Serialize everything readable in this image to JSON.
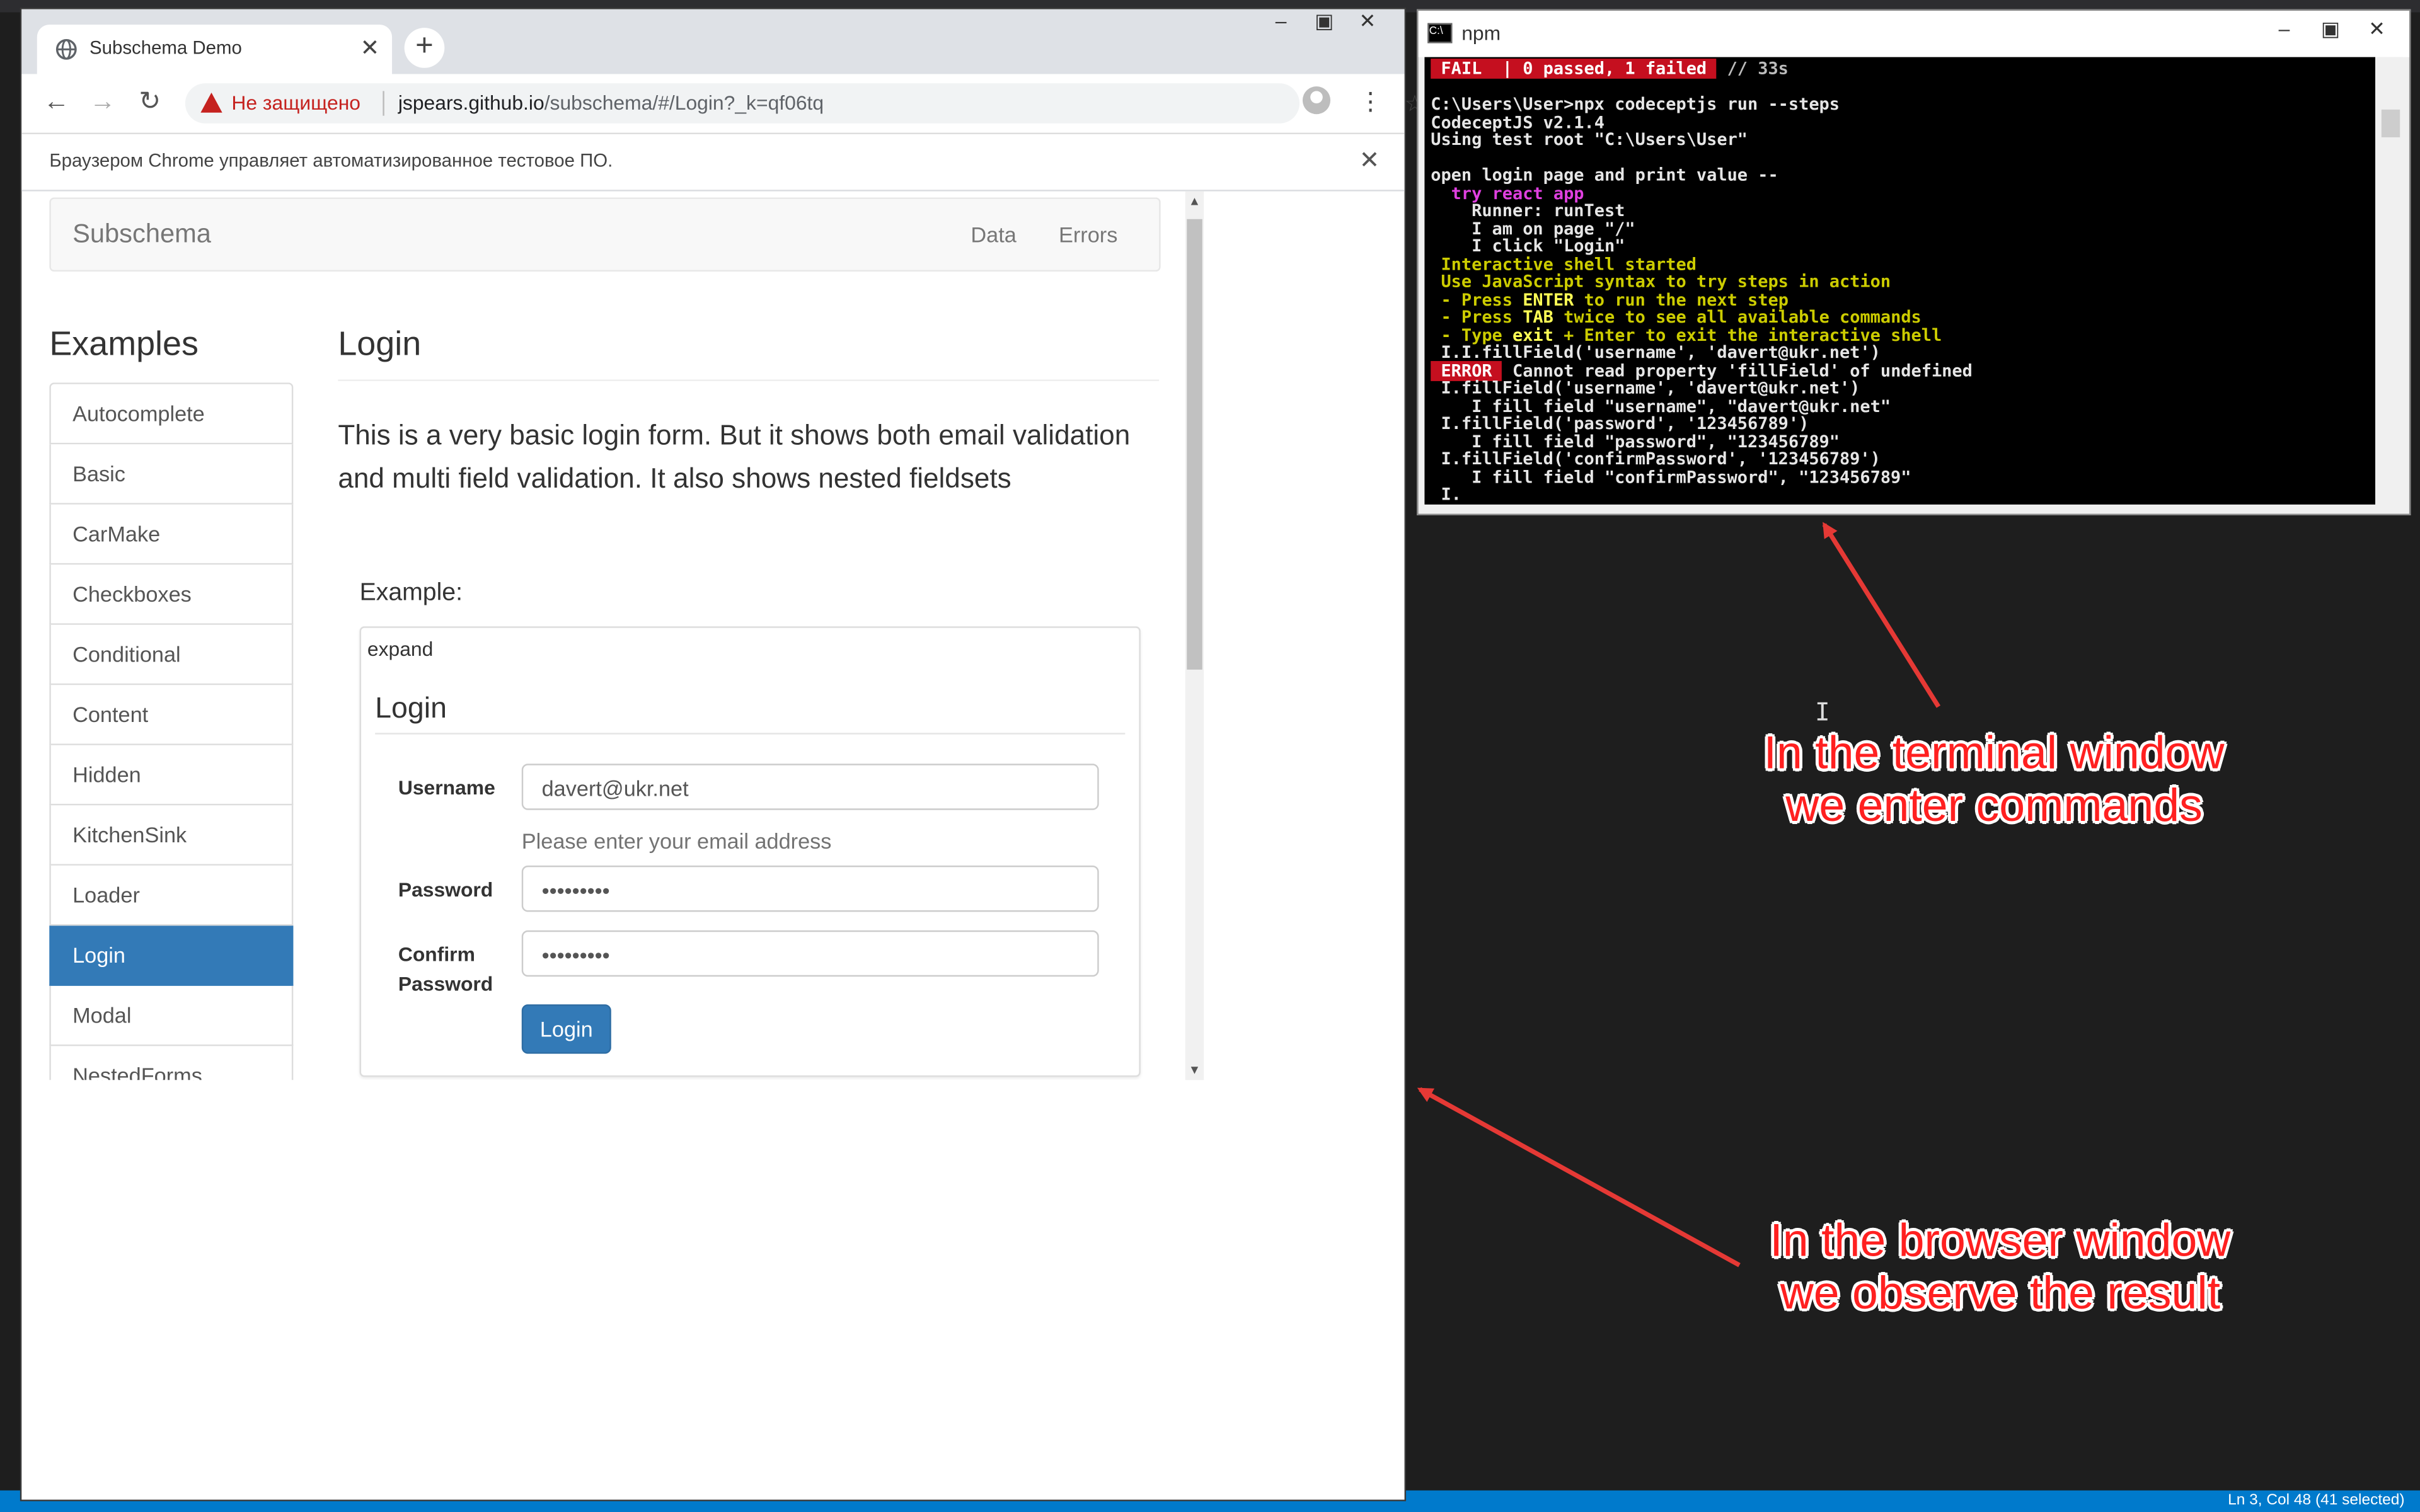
{
  "browser": {
    "tab_title": "Subschema Demo",
    "new_tab_symbol": "+",
    "warning_text": "Не защищено",
    "url_host": "jspears.github.io",
    "url_path": "/subschema/#/Login?_k=qf06tq",
    "infobar_text": "Браузером Chrome управляет автоматизированное тестовое ПО."
  },
  "site": {
    "brand": "Subschema",
    "nav": [
      "Data",
      "Errors"
    ],
    "examples_heading": "Examples",
    "examples": [
      "Autocomplete",
      "Basic",
      "CarMake",
      "Checkboxes",
      "Conditional",
      "Content",
      "Hidden",
      "KitchenSink",
      "Loader",
      "Login",
      "Modal",
      "NestedForms"
    ],
    "active_example": "Login",
    "title": "Login",
    "description": "This is a very basic login form. But it shows both email validation and multi field validation. It also shows nested fieldsets",
    "example_label": "Example:",
    "expand_label": "expand",
    "form": {
      "legend": "Login",
      "username_label": "Username",
      "username_value": "davert@ukr.net",
      "username_help": "Please enter your email address",
      "password_label": "Password",
      "password_value": "•••••••••",
      "confirm_label_1": "Confirm",
      "confirm_label_2": "Password",
      "confirm_value": "•••••••••",
      "submit_label": "Login"
    }
  },
  "terminal": {
    "title": "npm",
    "lines": [
      {
        "parts": [
          {
            "t": " FAIL  | 0 passed, 1 failed ",
            "c": "fail"
          },
          {
            "t": " // 33s",
            "c": "g"
          }
        ]
      },
      {
        "parts": [
          {
            "t": "",
            "c": "w"
          }
        ]
      },
      {
        "parts": [
          {
            "t": "C:\\Users\\User>npx codeceptjs run --steps",
            "c": "w"
          }
        ]
      },
      {
        "parts": [
          {
            "t": "CodeceptJS v2.1.4",
            "c": "w"
          }
        ]
      },
      {
        "parts": [
          {
            "t": "Using test root \"C:\\Users\\User\"",
            "c": "w"
          }
        ]
      },
      {
        "parts": [
          {
            "t": "",
            "c": "w"
          }
        ]
      },
      {
        "parts": [
          {
            "t": "open login page and print value --",
            "c": "w"
          }
        ]
      },
      {
        "parts": [
          {
            "t": "  try react app",
            "c": "m"
          }
        ]
      },
      {
        "parts": [
          {
            "t": "    Runner: runTest",
            "c": "w"
          }
        ]
      },
      {
        "parts": [
          {
            "t": "    I am on page \"/\"",
            "c": "w"
          }
        ]
      },
      {
        "parts": [
          {
            "t": "    I click \"Login\"",
            "c": "w"
          }
        ]
      },
      {
        "parts": [
          {
            "t": " Interactive shell started",
            "c": "y"
          }
        ]
      },
      {
        "parts": [
          {
            "t": " Use JavaScript syntax to try steps in action",
            "c": "y"
          }
        ]
      },
      {
        "parts": [
          {
            "t": " - Press ",
            "c": "y"
          },
          {
            "t": "ENTER",
            "c": "yb"
          },
          {
            "t": " to run the next step",
            "c": "y"
          }
        ]
      },
      {
        "parts": [
          {
            "t": " - Press ",
            "c": "y"
          },
          {
            "t": "TAB",
            "c": "yb"
          },
          {
            "t": " twice to see all available commands",
            "c": "y"
          }
        ]
      },
      {
        "parts": [
          {
            "t": " - Type ",
            "c": "y"
          },
          {
            "t": "exit",
            "c": "yb"
          },
          {
            "t": " + Enter to exit the interactive shell",
            "c": "y"
          }
        ]
      },
      {
        "parts": [
          {
            "t": " I.I.fillField('username', 'davert@ukr.net')",
            "c": "w"
          }
        ]
      },
      {
        "parts": [
          {
            "t": " ERROR ",
            "c": "err"
          },
          {
            "t": " Cannot read property 'fillField' of undefined",
            "c": "w"
          }
        ]
      },
      {
        "parts": [
          {
            "t": " I.fillField('username', 'davert@ukr.net')",
            "c": "w"
          }
        ]
      },
      {
        "parts": [
          {
            "t": "    I fill field \"username\", \"davert@ukr.net\"",
            "c": "w"
          }
        ]
      },
      {
        "parts": [
          {
            "t": " I.fillField('password', '123456789')",
            "c": "w"
          }
        ]
      },
      {
        "parts": [
          {
            "t": "    I fill field \"password\", \"123456789\"",
            "c": "w"
          }
        ]
      },
      {
        "parts": [
          {
            "t": " I.fillField('confirmPassword', '123456789')",
            "c": "w"
          }
        ]
      },
      {
        "parts": [
          {
            "t": "    I fill field \"confirmPassword\", \"123456789\"",
            "c": "w"
          }
        ]
      },
      {
        "parts": [
          {
            "t": " I.",
            "c": "w"
          }
        ]
      }
    ]
  },
  "annotations": {
    "terminal_note_1": "In the terminal window",
    "terminal_note_2": "we enter commands",
    "browser_note_1": "In the browser window",
    "browser_note_2": "we observe the result"
  },
  "statusbar": {
    "position": "Ln 3, Col 48 (41 selected)"
  },
  "colors": {
    "accent": "#337ab7",
    "annotation": "#ff2020",
    "fail_bg": "#c50f1f"
  }
}
